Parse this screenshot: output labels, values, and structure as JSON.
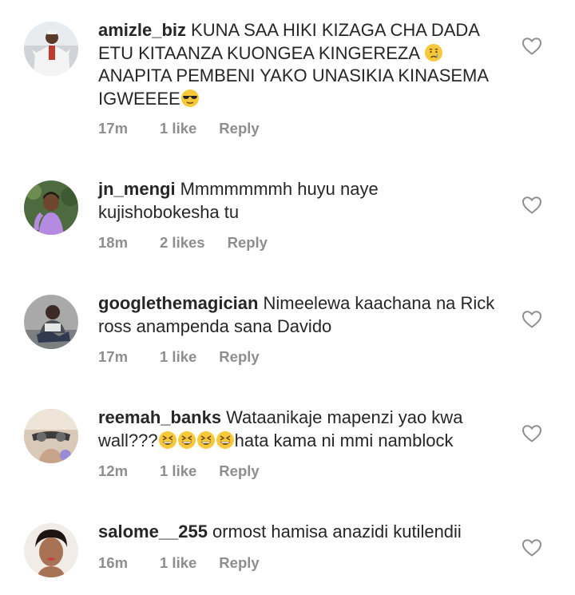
{
  "comments": [
    {
      "username": "amizle_biz",
      "text_part1": "KUNA SAA HIKI KIZAGA CHA DADA ETU KITAANZA KUONGEA KINGEREZA ",
      "emoji1": "crying-face",
      "text_part2": " ANAPITA PEMBENI YAKO UNASIKIA KINASEMA IGWEEEE",
      "emoji2": "sunglasses-face",
      "time": "17m",
      "likes": "1 like",
      "reply": "Reply"
    },
    {
      "username": "jn_mengi",
      "text": "Mmmmmmmh huyu naye kujishobokesha tu",
      "time": "18m",
      "likes": "2 likes",
      "reply": "Reply"
    },
    {
      "username": "googlethemagician",
      "text": "Nimeelewa kaachana na Rick ross anampenda sana Davido",
      "time": "17m",
      "likes": "1 like",
      "reply": "Reply"
    },
    {
      "username": "reemah_banks",
      "text_part1": "Wataanikaje mapenzi yao kwa wall???",
      "emojis": [
        "grinning-squinting-face",
        "grinning-squinting-face",
        "grinning-squinting-face",
        "grinning-squinting-face"
      ],
      "text_part2": "hata kama ni mmi namblock",
      "time": "12m",
      "likes": "1 like",
      "reply": "Reply"
    },
    {
      "username": "salome__255",
      "text": "ormost hamisa anazidi kutilendii",
      "time": "16m",
      "likes": "1 like",
      "reply": "Reply"
    }
  ],
  "colors": {
    "text": "#262626",
    "meta": "#8e8e8e",
    "heart": "#8e8e8e"
  }
}
